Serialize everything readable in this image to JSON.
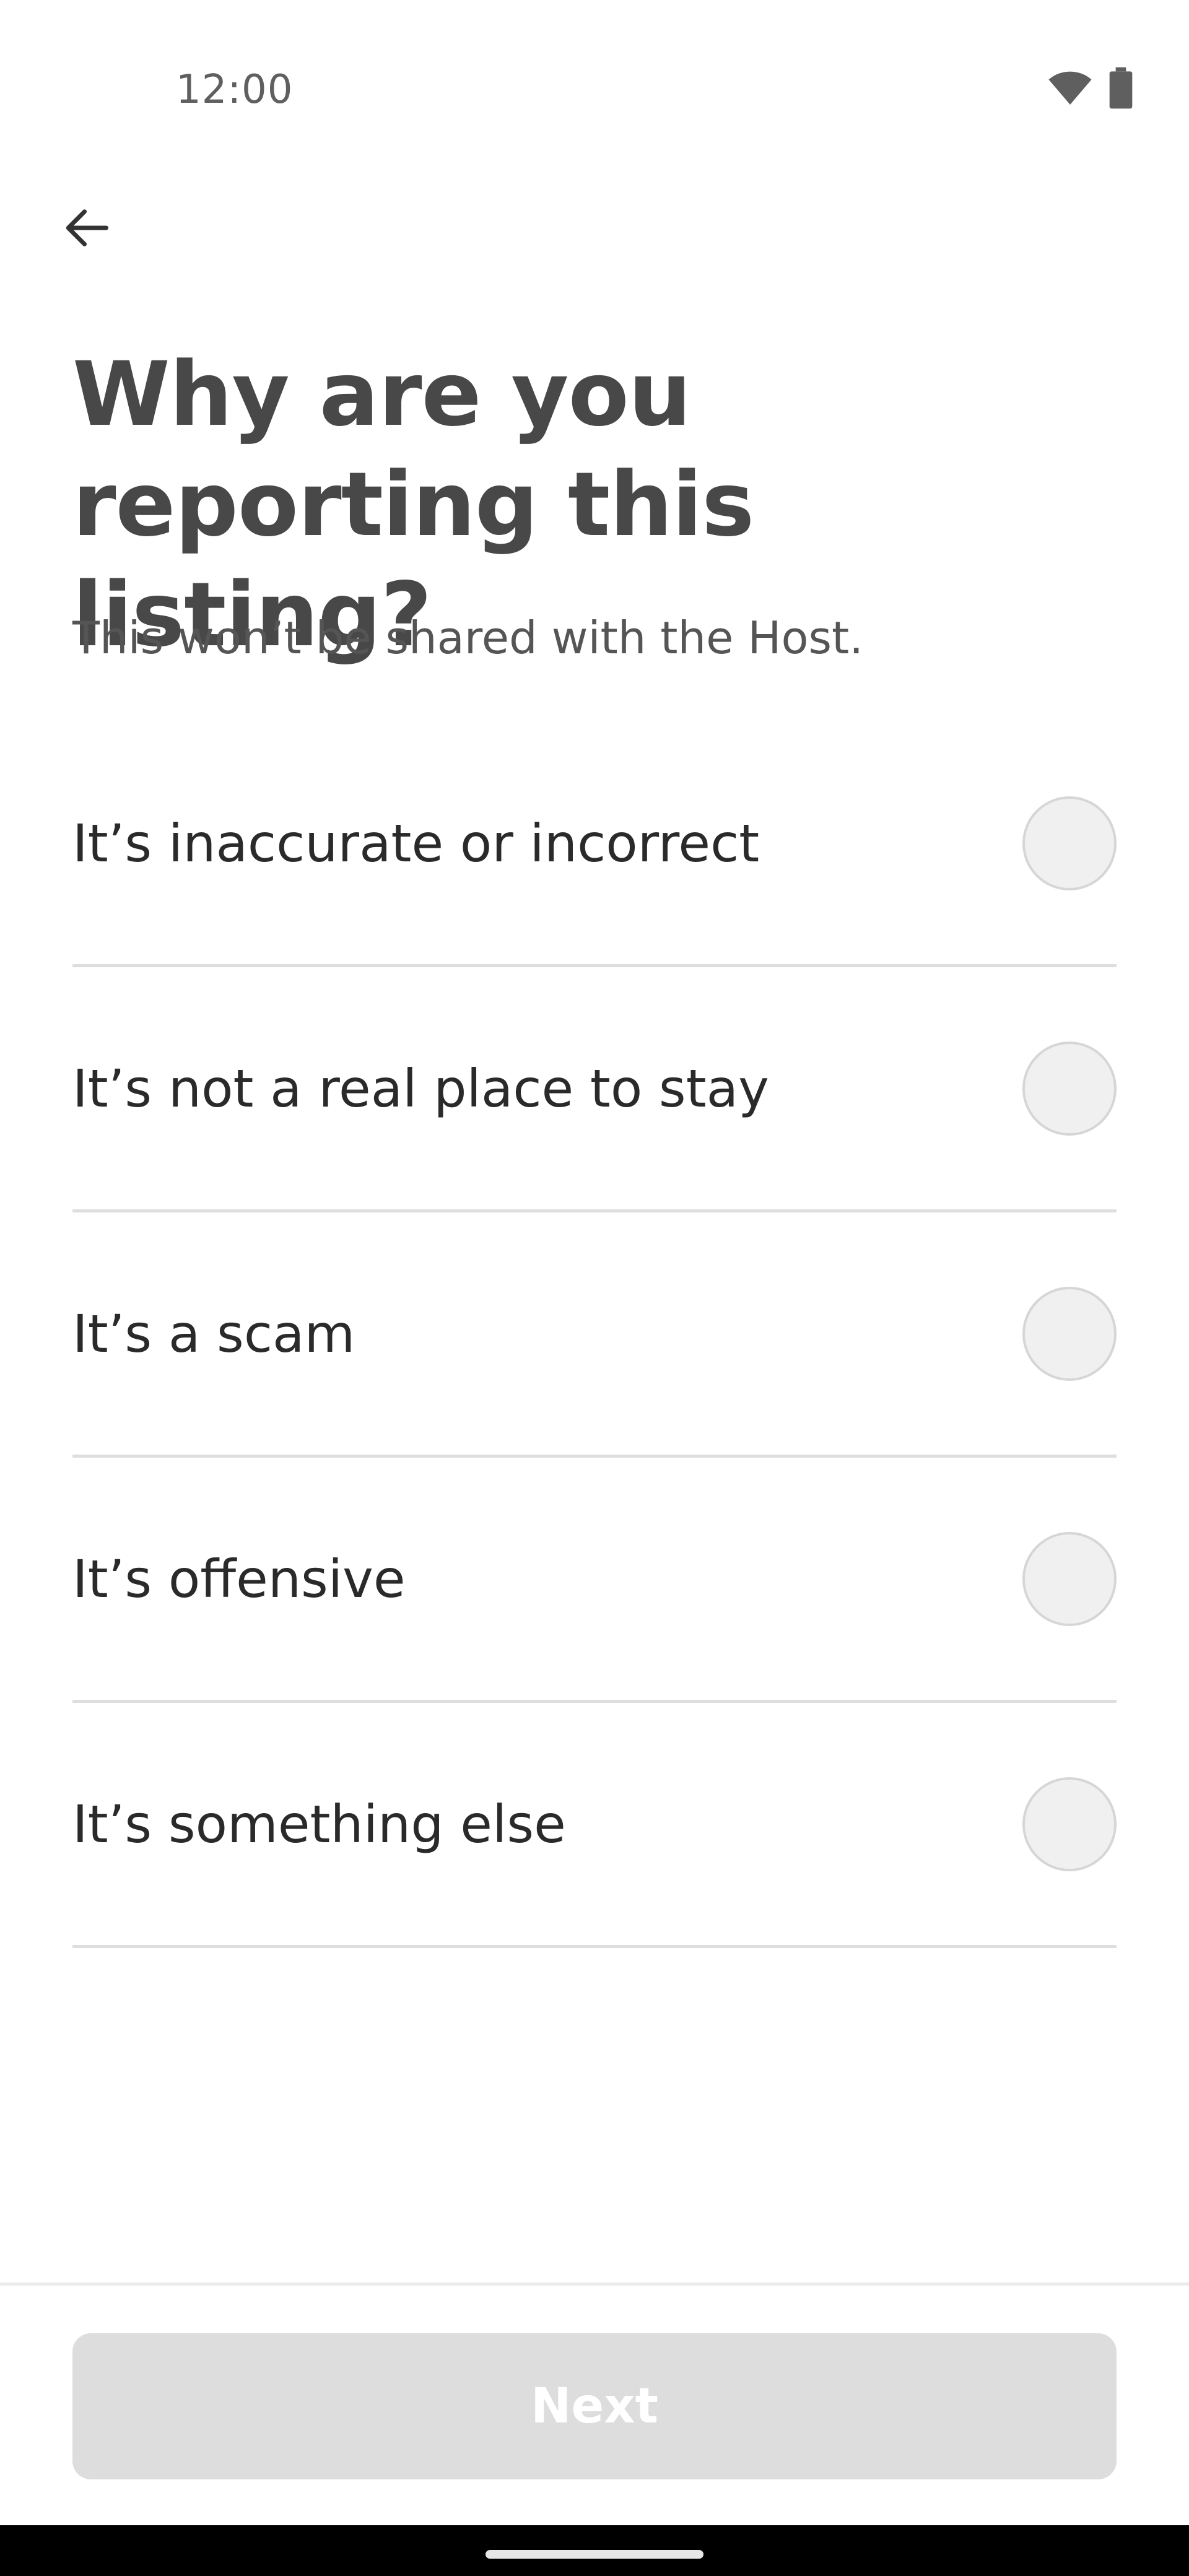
{
  "status_bar": {
    "time": "12:00",
    "wifi_icon": "wifi-icon",
    "battery_icon": "battery-icon"
  },
  "header": {
    "back_icon": "arrow-left-icon"
  },
  "main": {
    "title": "Why are you reporting this listing?",
    "subtitle": "This won’t be shared with the Host.",
    "options": [
      {
        "label": "It’s inaccurate or incorrect",
        "selected": false
      },
      {
        "label": "It’s not a real place to stay",
        "selected": false
      },
      {
        "label": "It’s a scam",
        "selected": false
      },
      {
        "label": "It’s offensive",
        "selected": false
      },
      {
        "label": "It’s something else",
        "selected": false
      }
    ]
  },
  "footer": {
    "next_label": "Next",
    "next_enabled": false
  },
  "colors": {
    "title": "#484848",
    "divider": "#dedede",
    "radio_fill": "#f0f0f0",
    "button_disabled": "#dddddd"
  }
}
